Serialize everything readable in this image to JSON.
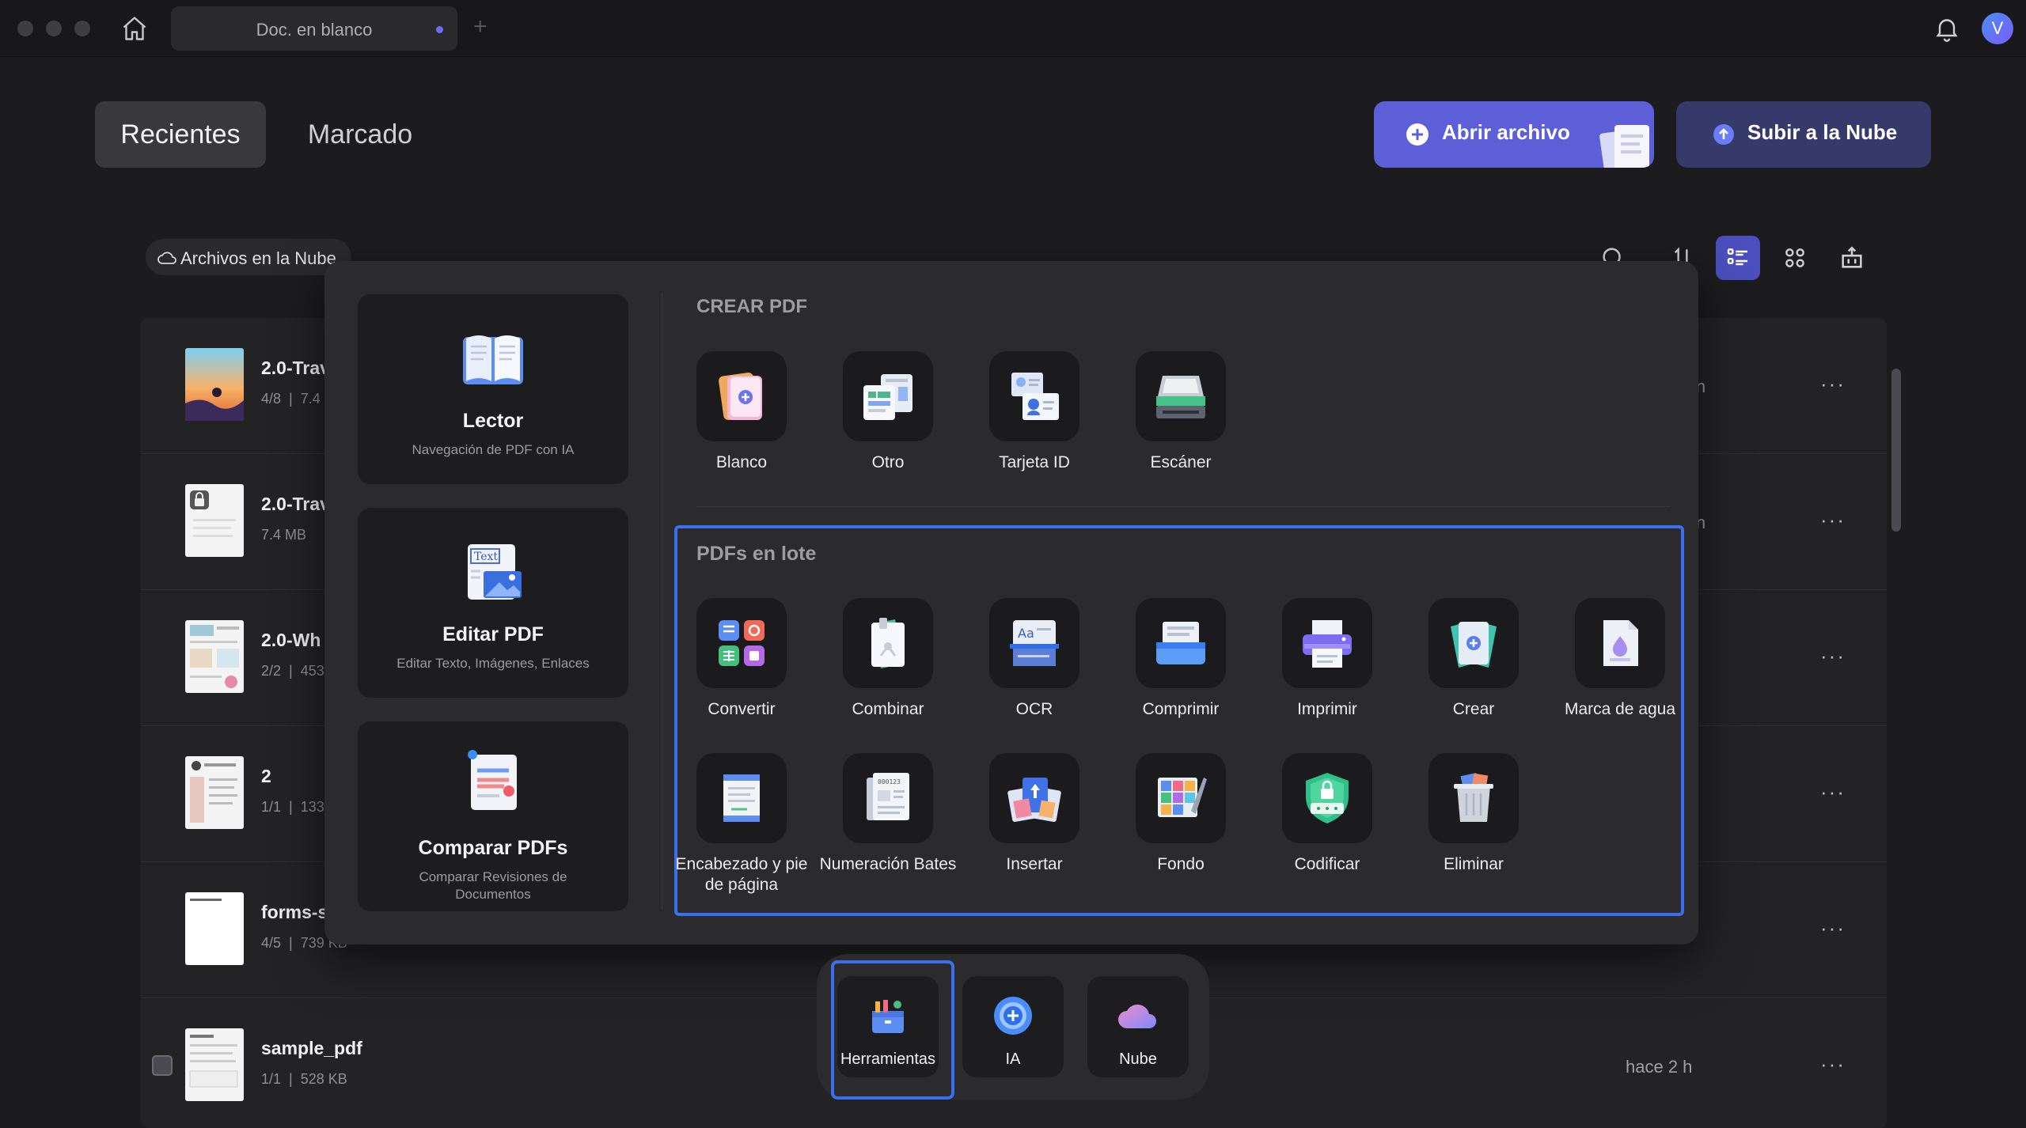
{
  "titlebar": {
    "tab_title": "Doc. en blanco",
    "new_tab": "+",
    "avatar_initial": "V"
  },
  "header": {
    "tabs": [
      {
        "label": "Recientes",
        "selected": true
      },
      {
        "label": "Marcado",
        "selected": false
      }
    ],
    "open_button": "Abrir archivo",
    "upload_button": "Subir a la Nube",
    "accent_color": "#5d5fd8"
  },
  "cloud_filter": "Archivos en la Nube",
  "files": [
    {
      "name": "2.0-Trav",
      "pages": "4/8",
      "size": "7.4"
    },
    {
      "name": "2.0-Trav",
      "size": "7.4 MB"
    },
    {
      "name": "2.0-Wh",
      "pages": "2/2",
      "size": "453"
    },
    {
      "name": "2",
      "pages": "1/1",
      "size": "133"
    },
    {
      "name": "forms-s",
      "pages": "4/5",
      "size": "739 KB"
    },
    {
      "name": "sample_pdf",
      "pages": "1/1",
      "size": "528 KB",
      "time": "hace 2 h"
    }
  ],
  "file_partial_right": [
    "in",
    "in",
    "n"
  ],
  "file_more": "···",
  "popup": {
    "cards": [
      {
        "title": "Lector",
        "subtitle": "Navegación de PDF con IA",
        "icon": "book-icon"
      },
      {
        "title": "Editar PDF",
        "subtitle": "Editar Texto, Imágenes, Enlaces",
        "icon": "edit-text-icon"
      },
      {
        "title": "Comparar PDFs",
        "subtitle": "Comparar Revisiones de Documentos",
        "icon": "compare-icon"
      }
    ],
    "create_title": "CREAR PDF",
    "create_tools": [
      "Blanco",
      "Otro",
      "Tarjeta ID",
      "Escáner"
    ],
    "batch_title": "PDFs en lote",
    "batch_tools_row1": [
      "Convertir",
      "Combinar",
      "OCR",
      "Comprimir",
      "Imprimir",
      "Crear",
      "Marca de agua"
    ],
    "batch_tools_row2": [
      "Encabezado y pie de página",
      "Numeración Bates",
      "Insertar",
      "Fondo",
      "Codificar",
      "Eliminar"
    ],
    "edit_icon_text": "Text",
    "ocr_icon_text": "Aa",
    "bates_icon_text": "000123",
    "highlight_color": "#3b6ff0"
  },
  "dock": {
    "items": [
      "Herramientas",
      "IA",
      "Nube"
    ],
    "selected": "Herramientas"
  }
}
